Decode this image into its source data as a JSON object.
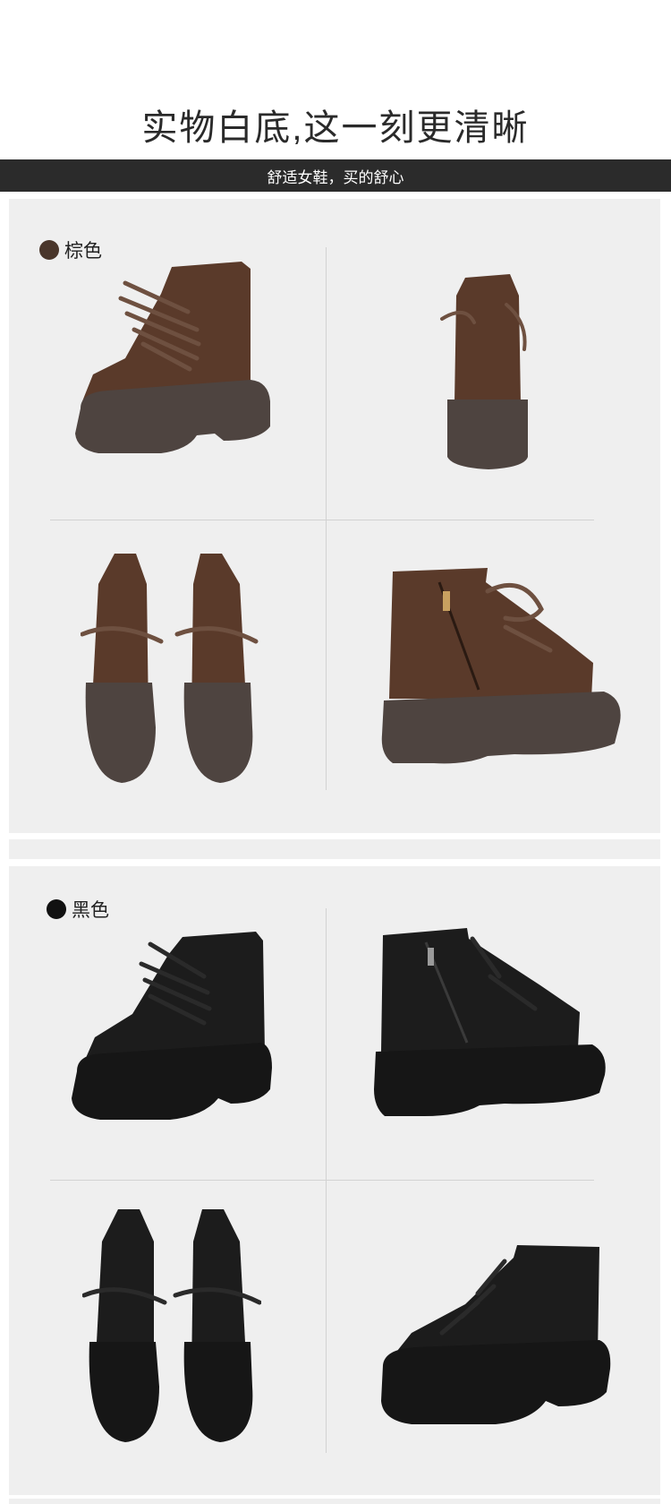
{
  "header": {
    "headline": "实物白底,这一刻更清晰",
    "banner": "舒适女鞋，买的舒心"
  },
  "sections": [
    {
      "label": "棕色",
      "dot_color": "#4a362b",
      "upper_color": "#5a3a2a",
      "sole_color": "#4e4440",
      "lace_color": "#6e5040"
    },
    {
      "label": "黑色",
      "dot_color": "#111111",
      "upper_color": "#1c1c1c",
      "sole_color": "#161616",
      "lace_color": "#2a2a2a"
    }
  ],
  "icons": {
    "brown_dot": "color-dot-icon",
    "black_dot": "color-dot-icon"
  }
}
